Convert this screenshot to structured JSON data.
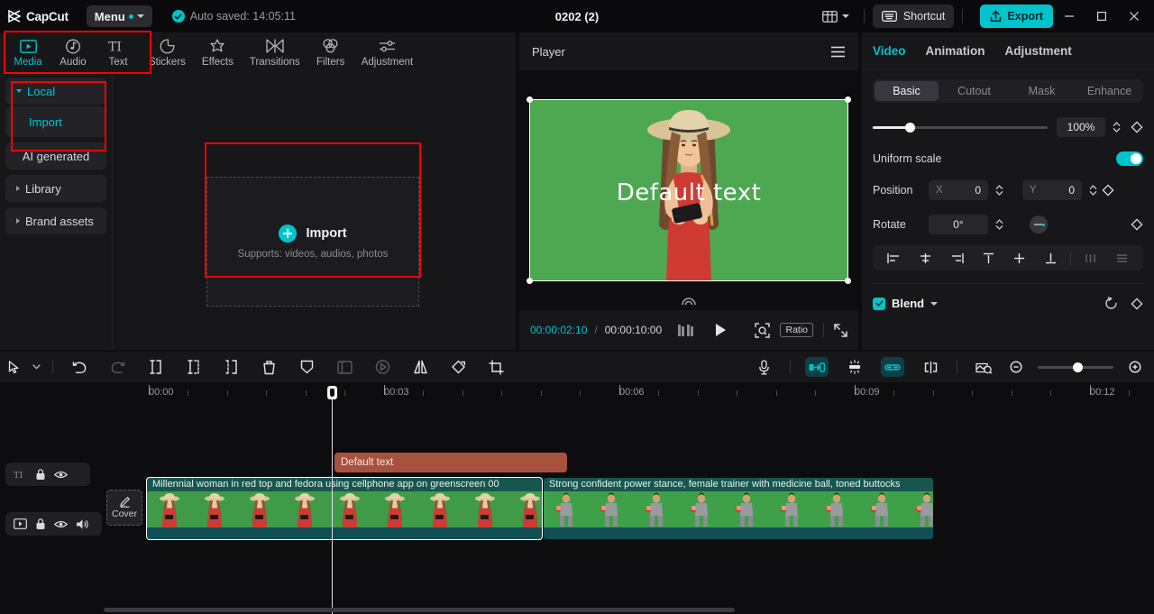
{
  "titlebar": {
    "app_name": "CapCut",
    "logo_icon": "capcut-logo-icon",
    "menu_label": "Menu",
    "autosave_text": "Auto saved: 14:05:11",
    "autosave_icon": "check-circle-icon",
    "project_title": "0202 (2)",
    "layout_icon": "layout-grid-icon",
    "shortcut_label": "Shortcut",
    "shortcut_icon": "keyboard-icon",
    "export_label": "Export",
    "export_icon": "upload-icon",
    "export_color": "#00c4cc",
    "minimize_icon": "minimize-icon",
    "maximize_icon": "maximize-icon",
    "close_icon": "close-icon"
  },
  "tabs": [
    {
      "label": "Media",
      "icon": "media-play-icon",
      "active": true
    },
    {
      "label": "Audio",
      "icon": "audio-note-icon",
      "active": false
    },
    {
      "label": "Text",
      "icon": "text-ti-icon",
      "active": false
    },
    {
      "label": "Stickers",
      "icon": "sticker-icon",
      "active": false
    },
    {
      "label": "Effects",
      "icon": "effects-star-icon",
      "active": false
    },
    {
      "label": "Transitions",
      "icon": "transitions-icon",
      "active": false
    },
    {
      "label": "Filters",
      "icon": "filters-icon",
      "active": false
    },
    {
      "label": "Adjustment",
      "icon": "adjustment-sliders-icon",
      "active": false
    }
  ],
  "library_nav": [
    {
      "label": "Local",
      "expandable": true,
      "expanded": true,
      "active": true
    },
    {
      "label": "Import",
      "expandable": false,
      "sub": true,
      "active": true
    },
    {
      "label": "AI generated",
      "expandable": false,
      "active": false
    },
    {
      "label": "Library",
      "expandable": true,
      "expanded": false,
      "active": false
    },
    {
      "label": "Brand assets",
      "expandable": true,
      "expanded": false,
      "active": false
    }
  ],
  "dropzone": {
    "title": "Import",
    "subtitle": "Supports: videos, audios, photos",
    "plus_icon": "plus-circle-icon"
  },
  "player": {
    "title": "Player",
    "menu_icon": "hamburger-icon",
    "overlay_text": "Default text",
    "current_time": "00:00:02:10",
    "time_separator": "/",
    "total_time": "00:00:10:00",
    "frames_icon": "frames-icon",
    "play_icon": "play-icon",
    "focus_icon": "focus-crop-icon",
    "ratio_label": "Ratio",
    "fullscreen_icon": "fullscreen-icon",
    "canvas_color": "#4da851"
  },
  "properties": {
    "tabs": [
      {
        "label": "Video",
        "active": true
      },
      {
        "label": "Animation",
        "active": false
      },
      {
        "label": "Adjustment",
        "active": false
      }
    ],
    "segments": [
      {
        "label": "Basic",
        "active": true
      },
      {
        "label": "Cutout",
        "active": false
      },
      {
        "label": "Mask",
        "active": false
      },
      {
        "label": "Enhance",
        "active": false
      }
    ],
    "scale_value": "100%",
    "scale_keyframe_icon": "keyframe-diamond-icon",
    "uniform_scale_label": "Uniform scale",
    "uniform_scale_on": true,
    "position_label": "Position",
    "position_x_axis": "X",
    "position_x_value": "0",
    "position_y_axis": "Y",
    "position_y_value": "0",
    "rotate_label": "Rotate",
    "rotate_value": "0°",
    "align_icons": [
      "align-left-icon",
      "align-center-horizontal-icon",
      "align-right-icon",
      "align-top-icon",
      "align-middle-vertical-icon",
      "align-bottom-icon",
      "distribute-horizontal-icon",
      "distribute-vertical-icon"
    ],
    "blend_label": "Blend",
    "blend_checked": true,
    "blend_caret_icon": "chevron-down-icon",
    "reset_icon": "reset-icon",
    "blend_keyframe_icon": "keyframe-diamond-icon"
  },
  "timeline_toolbar": {
    "left_icons": [
      {
        "name": "select-arrow-icon",
        "active": false
      },
      {
        "name": "chevron-down-icon",
        "active": false
      },
      {
        "name": "undo-icon",
        "active": false
      },
      {
        "name": "redo-icon",
        "active": false
      },
      {
        "name": "split-icon",
        "active": false
      },
      {
        "name": "trim-left-icon",
        "active": false
      },
      {
        "name": "trim-right-icon",
        "active": false
      },
      {
        "name": "delete-icon",
        "active": false
      },
      {
        "name": "freeze-icon",
        "active": false
      },
      {
        "name": "crop-frame-icon",
        "active": false
      },
      {
        "name": "reverse-icon",
        "active": false
      },
      {
        "name": "mirror-icon",
        "active": false
      },
      {
        "name": "rotate-icon",
        "active": false
      },
      {
        "name": "crop-icon",
        "active": false
      }
    ],
    "right_icons": [
      {
        "name": "microphone-icon",
        "active": false
      },
      {
        "name": "link-clip-icon",
        "active": true
      },
      {
        "name": "magnet-snap-icon",
        "active": false
      },
      {
        "name": "link-audio-video-icon",
        "active": true
      },
      {
        "name": "adsorb-icon",
        "active": false
      },
      {
        "name": "preview-thumbnail-icon",
        "active": false
      },
      {
        "name": "zoom-out-icon",
        "active": false
      },
      {
        "name": "zoom-in-icon",
        "active": false
      }
    ]
  },
  "ruler": {
    "labels": [
      "00:00",
      "00:03",
      "00:06",
      "00:09",
      "00:12"
    ]
  },
  "tracks": [
    {
      "type": "text",
      "header_icons": [
        "text-ti-icon",
        "lock-icon",
        "eye-icon"
      ],
      "clips": [
        {
          "label": "Default text",
          "color": "#a8513f",
          "selected": false
        }
      ]
    },
    {
      "type": "video",
      "header_icons": [
        "media-play-icon",
        "lock-icon",
        "eye-icon",
        "volume-icon"
      ],
      "cover_label": "Cover",
      "cover_icon": "pencil-icon",
      "clips": [
        {
          "label": "Millennial woman in red top and fedora using cellphone app on greenscreen  00",
          "selected": true
        },
        {
          "label": "Strong confident power stance, female trainer with medicine ball, toned buttocks",
          "selected": false
        }
      ]
    }
  ],
  "highlights": {
    "color": "#ff0000",
    "boxes": [
      "media-audio-text-tabs",
      "local-import-nav",
      "import-dropzone"
    ]
  }
}
